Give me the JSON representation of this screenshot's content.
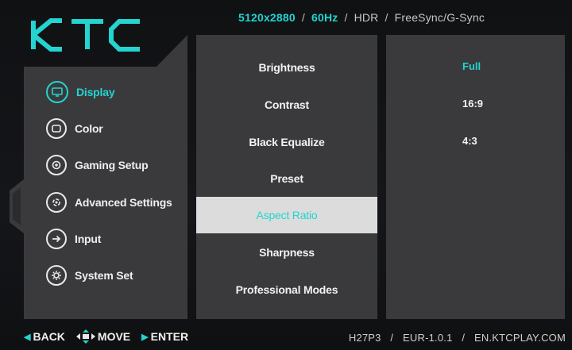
{
  "brand": {
    "logo_text": "KTC",
    "accent_color": "#23d4d0"
  },
  "status": {
    "resolution": "5120x2880",
    "refresh_rate": "60Hz",
    "hdr": "HDR",
    "sync": "FreeSync/G-Sync"
  },
  "sidebar": {
    "items": [
      {
        "label": "Display",
        "icon": "display-icon",
        "active": true
      },
      {
        "label": "Color",
        "icon": "color-icon",
        "active": false
      },
      {
        "label": "Gaming Setup",
        "icon": "gaming-icon",
        "active": false
      },
      {
        "label": "Advanced Settings",
        "icon": "advanced-settings-icon",
        "active": false
      },
      {
        "label": "Input",
        "icon": "input-icon",
        "active": false
      },
      {
        "label": "System Set",
        "icon": "system-set-icon",
        "active": false
      }
    ]
  },
  "submenu": {
    "items": [
      {
        "label": "Brightness",
        "selected": false
      },
      {
        "label": "Contrast",
        "selected": false
      },
      {
        "label": "Black Equalize",
        "selected": false
      },
      {
        "label": "Preset",
        "selected": false
      },
      {
        "label": "Aspect Ratio",
        "selected": true
      },
      {
        "label": "Sharpness",
        "selected": false
      },
      {
        "label": "Professional Modes",
        "selected": false
      }
    ]
  },
  "options": {
    "items": [
      {
        "label": "Full",
        "active": true
      },
      {
        "label": "16:9",
        "active": false
      },
      {
        "label": "4:3",
        "active": false
      }
    ]
  },
  "footer": {
    "back": "BACK",
    "move": "MOVE",
    "enter": "ENTER",
    "model": "H27P3",
    "firmware": "EUR-1.0.1",
    "website": "EN.KTCPLAY.COM"
  }
}
